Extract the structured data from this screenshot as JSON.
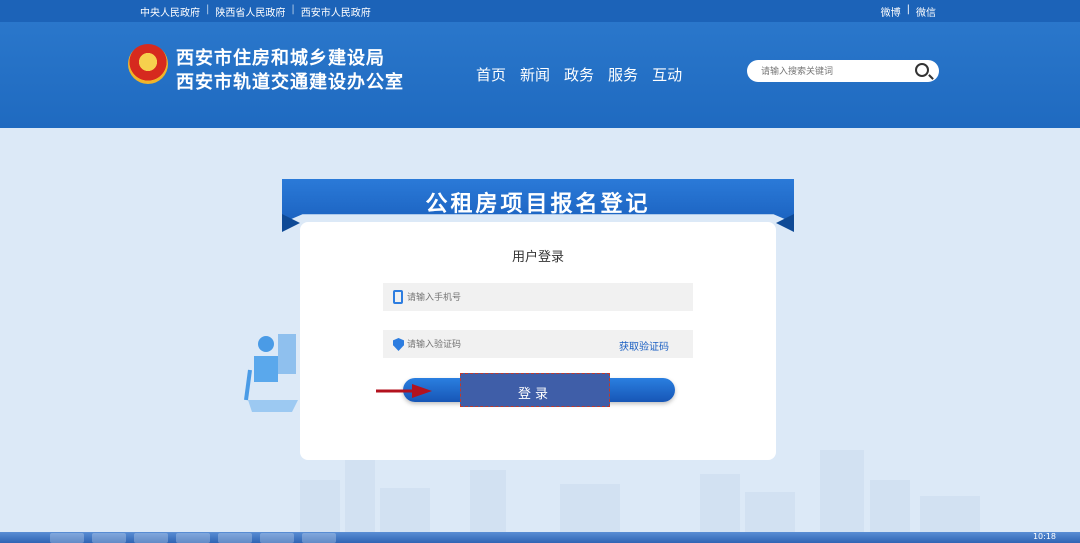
{
  "top_links": [
    "中央人民政府",
    "陕西省人民政府",
    "西安市人民政府"
  ],
  "top_right": [
    "微博",
    "微信"
  ],
  "header": {
    "title_line1": "西安市住房和城乡建设局",
    "title_line2": "西安市轨道交通建设办公室",
    "nav": [
      "首页",
      "新闻",
      "政务",
      "服务",
      "互动"
    ],
    "search_placeholder": "请输入搜索关键词"
  },
  "banner": {
    "title": "公租房项目报名登记"
  },
  "login": {
    "title": "用户登录",
    "phone_placeholder": "请输入手机号",
    "code_placeholder": "请输入验证码",
    "get_code_label": "获取验证码",
    "submit_label": "登录"
  },
  "taskbar": {
    "clock": "10:18"
  },
  "colors": {
    "brand_blue": "#1f6ac0",
    "page_bg": "#dce9f7",
    "annotation_red": "#b3121e"
  }
}
